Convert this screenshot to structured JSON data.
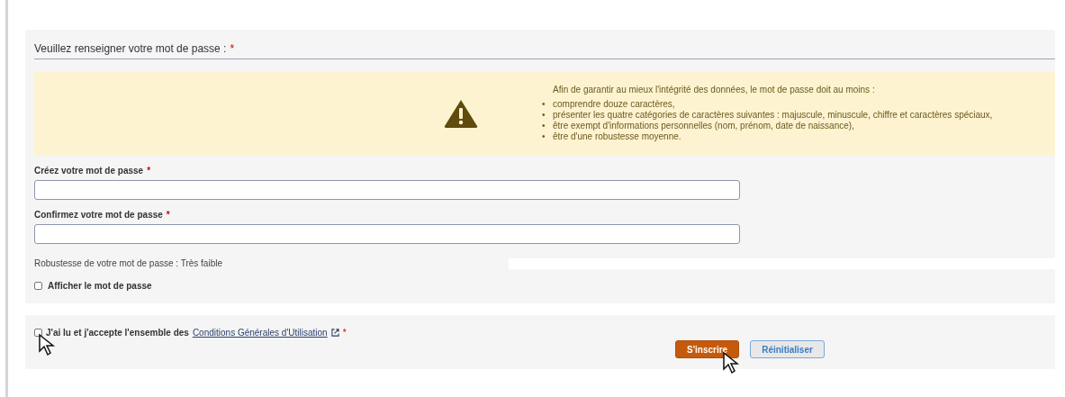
{
  "password_section": {
    "heading": "Veuillez renseigner votre mot de passe :",
    "heading_required": "*",
    "notice": {
      "marker": "•",
      "intro": "Afin de garantir au mieux l'intégrité des données, le mot de passe doit au moins :",
      "rules": [
        "comprendre douze caractères,",
        "présenter les quatre catégories de caractères suivantes : majuscule, minuscule, chiffre et caractères spéciaux,",
        "être exempt d'informations personnelles (nom, prénom, date de naissance),",
        "être d'une robustesse moyenne."
      ]
    },
    "fields": [
      {
        "label": "Créez votre mot de passe",
        "required": "*"
      },
      {
        "label": "Confirmez votre mot de passe",
        "required": "*"
      }
    ],
    "strength": {
      "label": "Robustesse de votre mot de passe : Très faible",
      "level": 0
    },
    "show_password": {
      "label": "Afficher le mot de passe",
      "checked": false
    }
  },
  "terms": {
    "text": "J'ai lu et j'accepte l'ensemble des",
    "link": "Conditions Générales d'Utilisation",
    "required": "*",
    "checked": false
  },
  "buttons": [
    {
      "label": "S'inscrire",
      "kind": "primary"
    },
    {
      "label": "Réinitialiser",
      "kind": "secondary"
    }
  ]
}
